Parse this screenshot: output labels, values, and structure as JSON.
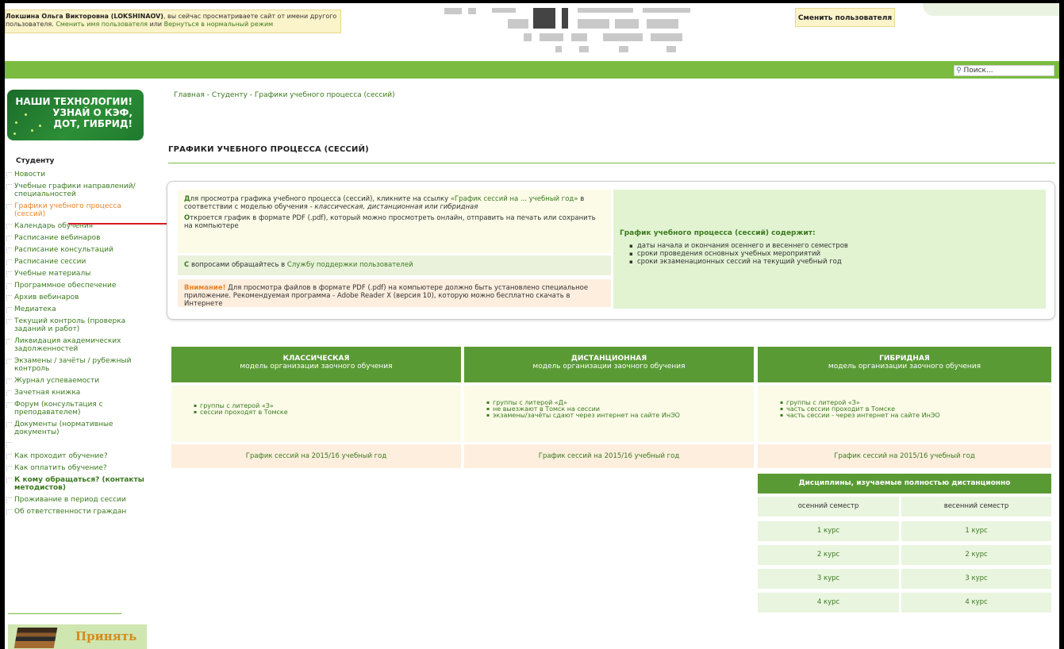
{
  "impersonation": {
    "user": "Локшина Ольга Викторовна (LOKSHINAOV)",
    "text1": ", вы сейчас просматриваете сайт от имени другого",
    "text2": "пользователя. ",
    "change_link": "Сменить имя пользователя",
    "or": " или ",
    "return_link": "Вернуться в нормальный режим"
  },
  "switch_user": "Сменить пользователя",
  "search": {
    "placeholder": "Поиск..."
  },
  "promo": {
    "line1": "НАШИ ТЕХНОЛОГИИ!",
    "line2": "УЗНАЙ О КЭФ,",
    "line3": "ДОТ, ГИБРИД!"
  },
  "sidebar": {
    "title": "Студенту",
    "items": [
      {
        "label": "Новости"
      },
      {
        "label": "Учебные графики направлений/ специальностей"
      },
      {
        "label": "Графики учебного процесса (сессий)"
      },
      {
        "label": "Календарь обучения"
      },
      {
        "label": "Расписание вебинаров"
      },
      {
        "label": "Расписание консультаций"
      },
      {
        "label": "Расписание сессии"
      },
      {
        "label": "Учебные материалы"
      },
      {
        "label": "Программное обеспечение"
      },
      {
        "label": "Архив вебинаров"
      },
      {
        "label": "Медиатека"
      },
      {
        "label": "Текущий контроль (проверка заданий и работ)"
      },
      {
        "label": "Ликвидация академических задолженностей"
      },
      {
        "label": "Экзамены / зачёты / рубежный контроль"
      },
      {
        "label": "Журнал успеваемости"
      },
      {
        "label": "Зачетная книжка"
      },
      {
        "label": "Форум (консультация с преподавателем)"
      },
      {
        "label": "Документы (нормативные документы)"
      },
      {
        "label": ""
      },
      {
        "label": "Как проходит обучение?"
      },
      {
        "label": "Как оплатить обучение?"
      },
      {
        "label": "К кому обращаться? (контакты методистов)"
      },
      {
        "label": "Проживание в период сессии"
      },
      {
        "label": "Об ответственности граждан"
      }
    ],
    "banner": "Принять"
  },
  "breadcrumb": "Главная - Студенту - Графики учебного процесса (сессий)",
  "page_title": "ГРАФИКИ УЧЕБНОГО ПРОЦЕССА (СЕССИЙ)",
  "info": {
    "a_cap": "Д",
    "a_text1": "ля просмотра графика учебного процесса (сессий), кликните на ссылку ",
    "a_link": "«График сессий на ... учебный год»",
    "a_text2": " в соответствии с моделью обучения - ",
    "a_models": "классическая, дистанционная или гибридная",
    "a_cap2": "О",
    "a_text3": "ткроется график в формате PDF (.pdf), который можно просмотреть онлайн, отправить на печать или сохранить на компьютере",
    "b_cap": "С",
    "b_text": " вопросами обращайтесь в ",
    "b_link": "Службу поддержки пользователей",
    "c_warn": "Внимание!",
    "c_text": " Для просмотра файлов в формате PDF (.pdf) на компьютере должно быть установлено специальное приложение. Рекомендуемая программа - Adobe Reader X (версия 10), которую можно бесплатно скачать в Интернете",
    "d_title": "График учебного процесса (сессий) содержит:",
    "d_items": [
      "даты начала и окончания осеннего и весеннего семестров",
      "сроки проведения основных учебных мероприятий",
      "сроки экзаменационных сессий на текущий учебный год"
    ]
  },
  "models": [
    {
      "title": "КЛАССИЧЕСКАЯ",
      "subtitle": "модель организации заочного обучения",
      "items": [
        "группы с литерой «З»",
        "сессии проходят в Томске"
      ],
      "link": "График сессий на 2015/16 учебный год"
    },
    {
      "title": "ДИСТАНЦИОННАЯ",
      "subtitle": "модель организации заочного обучения",
      "items": [
        "группы с литерой «Д»",
        "не выезжают в Томск на сессии",
        "экзамены/зачёты сдают через интернет на сайте ИнЭО"
      ],
      "link": "График сессий на 2015/16 учебный год"
    },
    {
      "title": "ГИБРИДНАЯ",
      "subtitle": "модель организации заочного обучения",
      "items": [
        "группы с литерой «З»",
        "часть сессии проходит в Томске",
        "часть сессии - через интернет на сайте ИнЭО"
      ],
      "link": "График сессий на 2015/16 учебный год"
    }
  ],
  "disciplines": {
    "title": "Дисциплины, изучаемые полностью дистанционно",
    "headers": [
      "осенний семестр",
      "весенний семестр"
    ],
    "rows": [
      [
        "1 курс",
        "1 курс"
      ],
      [
        "2 курс",
        "2 курс"
      ],
      [
        "3 курс",
        "3 курс"
      ],
      [
        "4 курс",
        "4 курс"
      ]
    ]
  }
}
